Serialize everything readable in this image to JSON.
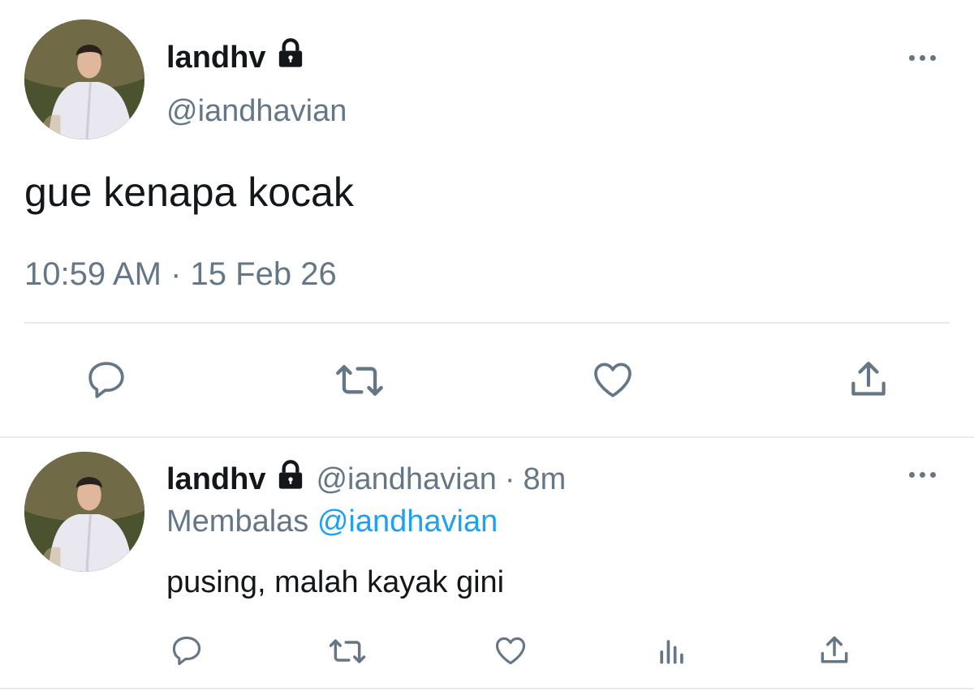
{
  "tweet": {
    "display_name": "landhv",
    "handle": "@iandhavian",
    "text": "gue kenapa kocak",
    "timestamp": "10:59 AM · 15 Feb 26",
    "actions": [
      "reply-icon",
      "retweet-icon",
      "like-icon",
      "share-icon"
    ]
  },
  "reply": {
    "display_name": "landhv",
    "handle": "@iandhavian",
    "separator": "·",
    "time_ago": "8m",
    "replying_prefix": "Membalas",
    "replying_to": "@iandhavian",
    "text": "pusing, malah kayak gini",
    "actions": [
      "reply-icon",
      "retweet-icon",
      "like-icon",
      "analytics-icon",
      "share-icon"
    ]
  },
  "colors": {
    "text": "#14171a",
    "muted": "#657786",
    "link": "#1da1f2",
    "divider": "#e6ecf0"
  }
}
